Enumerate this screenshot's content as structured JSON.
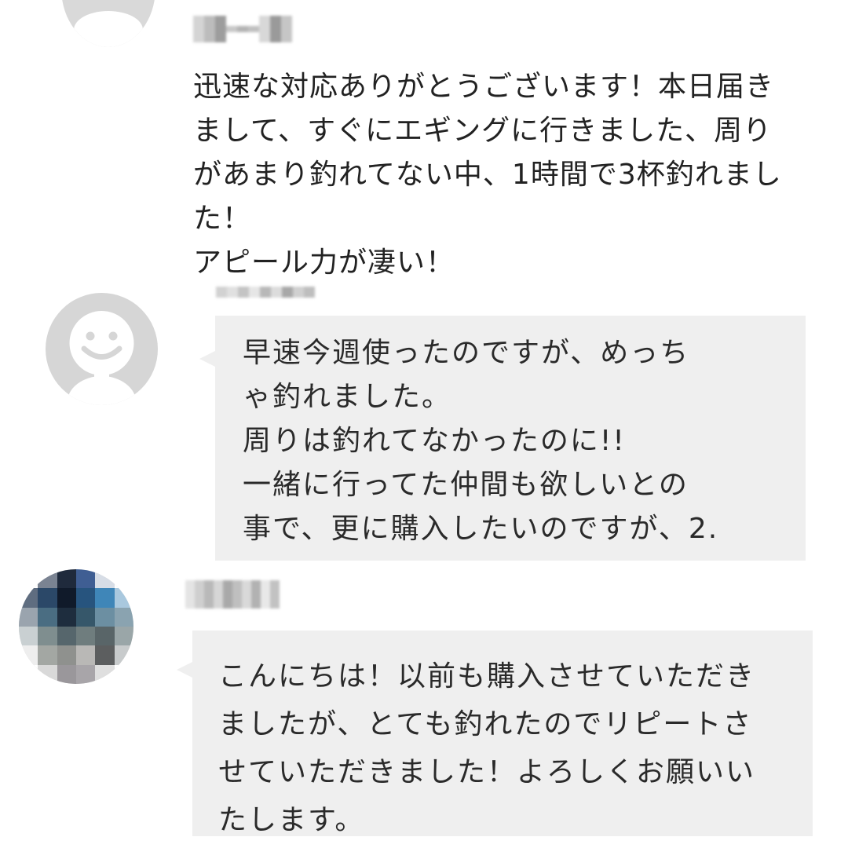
{
  "comments": [
    {
      "author_name": "",
      "avatar": "default-person-icon",
      "text_lines": [
        "迅速な対応ありがとうございます！本日届き",
        "まして、すぐにエギングに行きました、周り",
        "があまり釣れてない中、1時間で3杯釣れまし",
        "た！",
        "アピール力が凄い！"
      ]
    },
    {
      "author_name": "",
      "avatar": "default-smiley-person-icon",
      "text_lines": [
        "早速今週使ったのですが、めっち",
        "ゃ釣れました。",
        "周りは釣れてなかったのに!!",
        "一緒に行ってた仲間も欲しいとの",
        "事で、更に購入したいのですが、2."
      ]
    },
    {
      "author_name": "",
      "avatar": "pixelated-photo-avatar",
      "text_lines": [
        "こんにちは！以前も購入させていただき",
        "ましたが、とても釣れたのでリピートさ",
        "せていただきました！よろしくお願いい",
        "たします。"
      ]
    }
  ],
  "colors": {
    "background": "#ffffff",
    "bubble": "#efefef",
    "text": "#222222",
    "avatar_default": "#d6d6d6",
    "avatar_face": "#ffffff",
    "blurred_name": "#c4c4c4"
  }
}
